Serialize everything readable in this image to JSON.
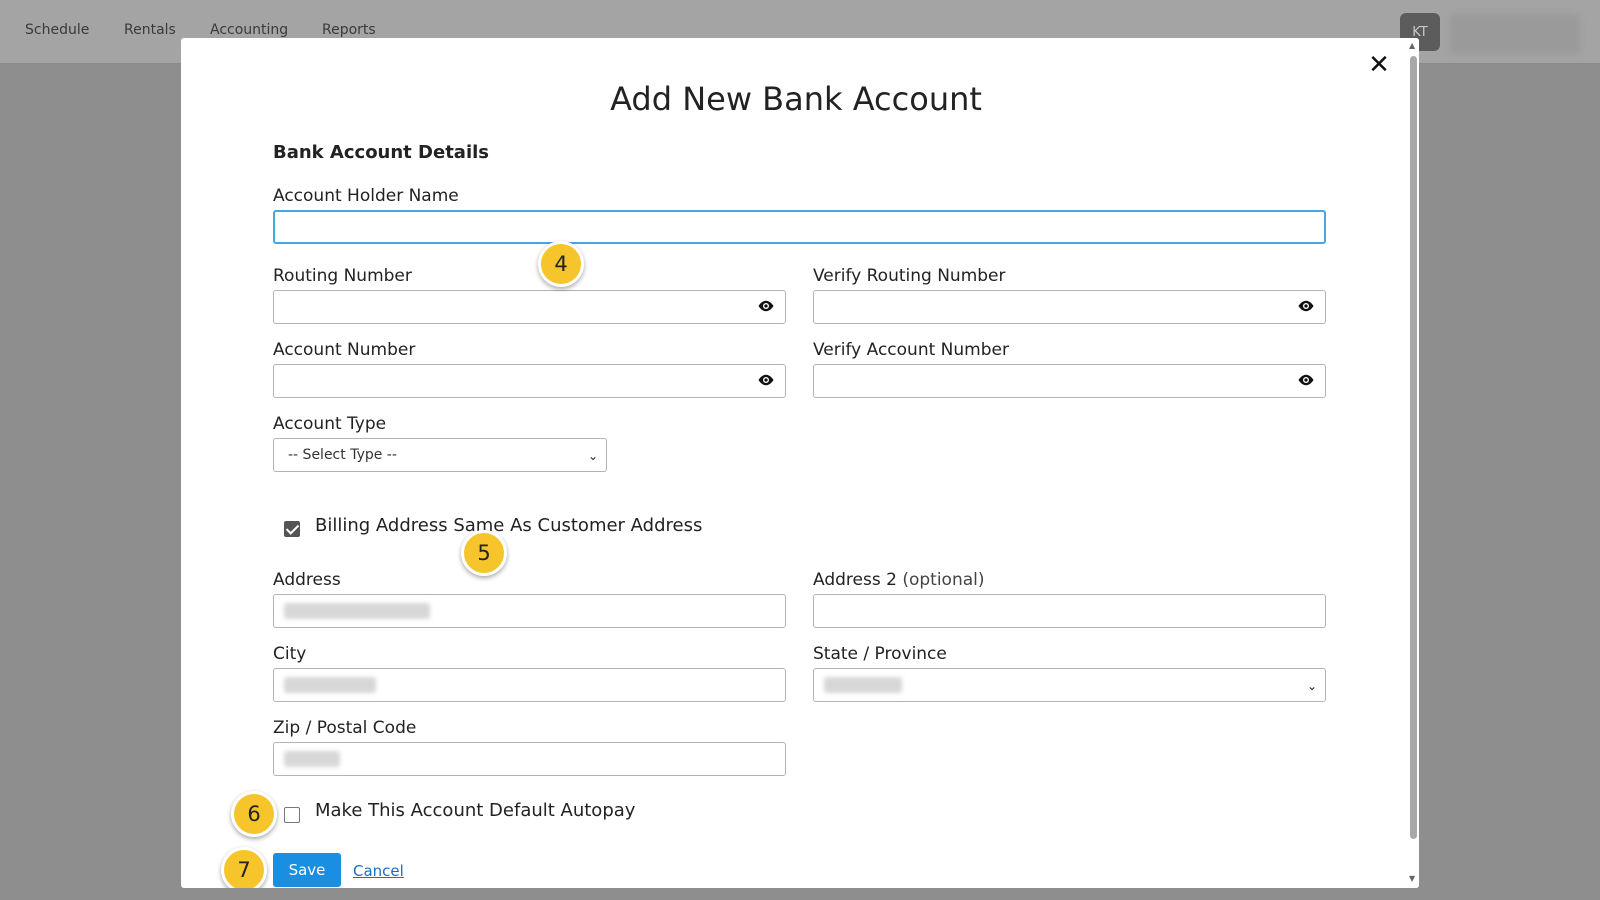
{
  "nav": {
    "items": [
      "Schedule",
      "Rentals",
      "Accounting",
      "Reports"
    ],
    "avatar_initials": "KT"
  },
  "modal": {
    "title": "Add New Bank Account",
    "section_title": "Bank Account Details",
    "fields": {
      "account_holder_name": {
        "label": "Account Holder Name",
        "value": ""
      },
      "routing_number": {
        "label": "Routing Number",
        "value": ""
      },
      "verify_routing_number": {
        "label": "Verify Routing Number",
        "value": ""
      },
      "account_number": {
        "label": "Account Number",
        "value": ""
      },
      "verify_account_number": {
        "label": "Verify Account Number",
        "value": ""
      },
      "account_type": {
        "label": "Account Type",
        "selected": "-- Select Type --"
      },
      "address": {
        "label": "Address"
      },
      "address2": {
        "label": "Address 2",
        "optional": "(optional)",
        "value": ""
      },
      "city": {
        "label": "City"
      },
      "state": {
        "label": "State / Province"
      },
      "zip": {
        "label": "Zip / Postal Code"
      }
    },
    "billing_same": {
      "label": "Billing Address Same As Customer Address",
      "checked": true
    },
    "default_autopay": {
      "label": "Make This Account Default Autopay",
      "checked": false
    },
    "save_label": "Save",
    "cancel_label": "Cancel"
  },
  "annotations": [
    "4",
    "5",
    "6",
    "7"
  ],
  "colors": {
    "accent": "#1a8ee0",
    "focus_border": "#47a6df",
    "marker": "#f6c42b"
  },
  "icons": {
    "close": "close-icon",
    "eye": "eye-icon",
    "chevron": "chevron-down-icon"
  }
}
